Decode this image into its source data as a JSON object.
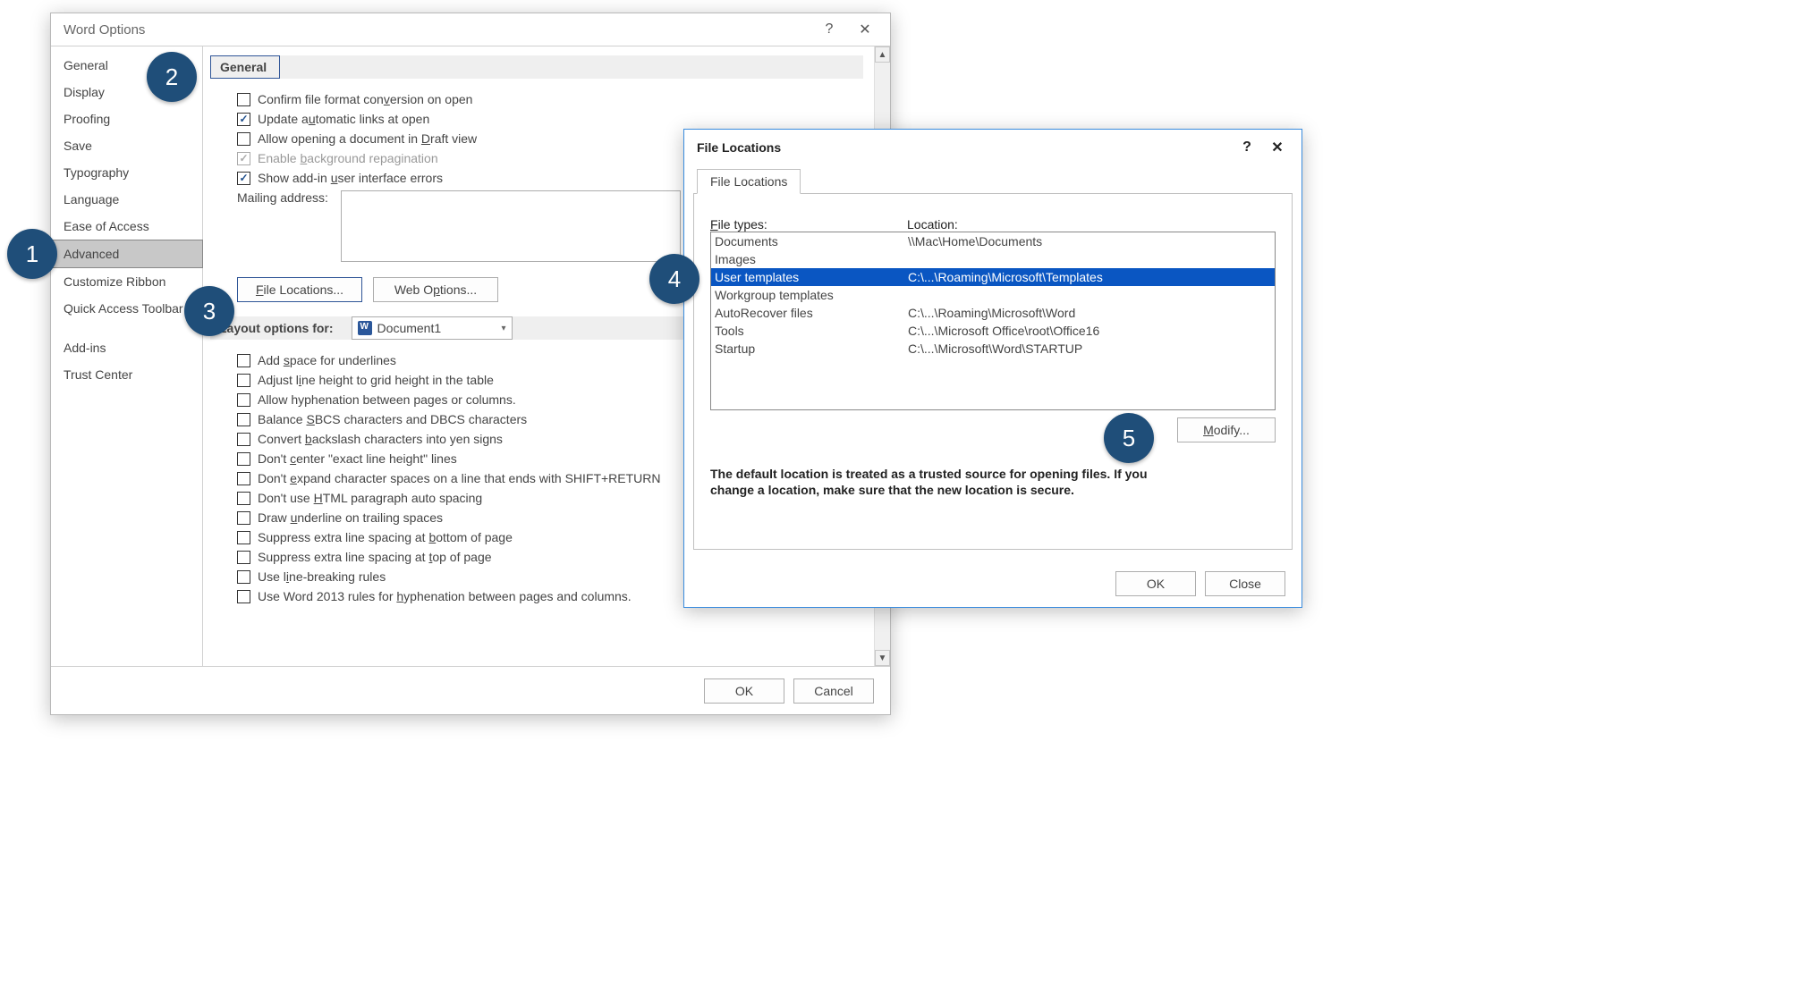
{
  "optionsDialog": {
    "title": "Word Options",
    "sidebar": [
      "General",
      "Display",
      "Proofing",
      "Save",
      "Typography",
      "Language",
      "Ease of Access",
      "Advanced",
      "Customize Ribbon",
      "Quick Access Toolbar",
      "Add-ins",
      "Trust Center"
    ],
    "sidebarSelectedIndex": 7,
    "generalSection": {
      "header": "General",
      "confirmFileFormat": "Confirm file format conversion on open",
      "updateLinks": "Update automatic links at open",
      "allowDraft": "Allow opening a document in Draft view",
      "enableBackground": "Enable background repagination",
      "showAddin": "Show add-in user interface errors",
      "mailingLabel": "Mailing address:",
      "fileLocationsBtn": "File Locations...",
      "webOptionsBtn": "Web Options..."
    },
    "layoutSection": {
      "header": "Layout options for:",
      "docName": "Document1",
      "items": [
        "Add space for underlines",
        "Adjust line height to grid height in the table",
        "Allow hyphenation between pages or columns.",
        "Balance SBCS characters and DBCS characters",
        "Convert backslash characters into yen signs",
        "Don't center \"exact line height\" lines",
        "Don't expand character spaces on a line that ends with SHIFT+RETURN",
        "Don't use HTML paragraph auto spacing",
        "Draw underline on trailing spaces",
        "Suppress extra line spacing at bottom of page",
        "Suppress extra line spacing at top of page",
        "Use line-breaking rules",
        "Use Word 2013 rules for hyphenation between pages and columns."
      ]
    },
    "footer": {
      "ok": "OK",
      "cancel": "Cancel"
    }
  },
  "fileLocDialog": {
    "title": "File Locations",
    "tab": "File Locations",
    "col1": "File types:",
    "col2": "Location:",
    "rows": [
      {
        "type": "Documents",
        "loc": "\\\\Mac\\Home\\Documents"
      },
      {
        "type": "Images",
        "loc": ""
      },
      {
        "type": "User templates",
        "loc": "C:\\...\\Roaming\\Microsoft\\Templates"
      },
      {
        "type": "Workgroup templates",
        "loc": ""
      },
      {
        "type": "AutoRecover files",
        "loc": "C:\\...\\Roaming\\Microsoft\\Word"
      },
      {
        "type": "Tools",
        "loc": "C:\\...\\Microsoft Office\\root\\Office16"
      },
      {
        "type": "Startup",
        "loc": "C:\\...\\Microsoft\\Word\\STARTUP"
      }
    ],
    "selectedRowIndex": 2,
    "modify": "Modify...",
    "note": "The default location is treated as a trusted source for opening files. If you change a location, make sure that the new location is secure.",
    "ok": "OK",
    "close": "Close"
  },
  "bubbles": [
    "1",
    "2",
    "3",
    "4",
    "5"
  ]
}
